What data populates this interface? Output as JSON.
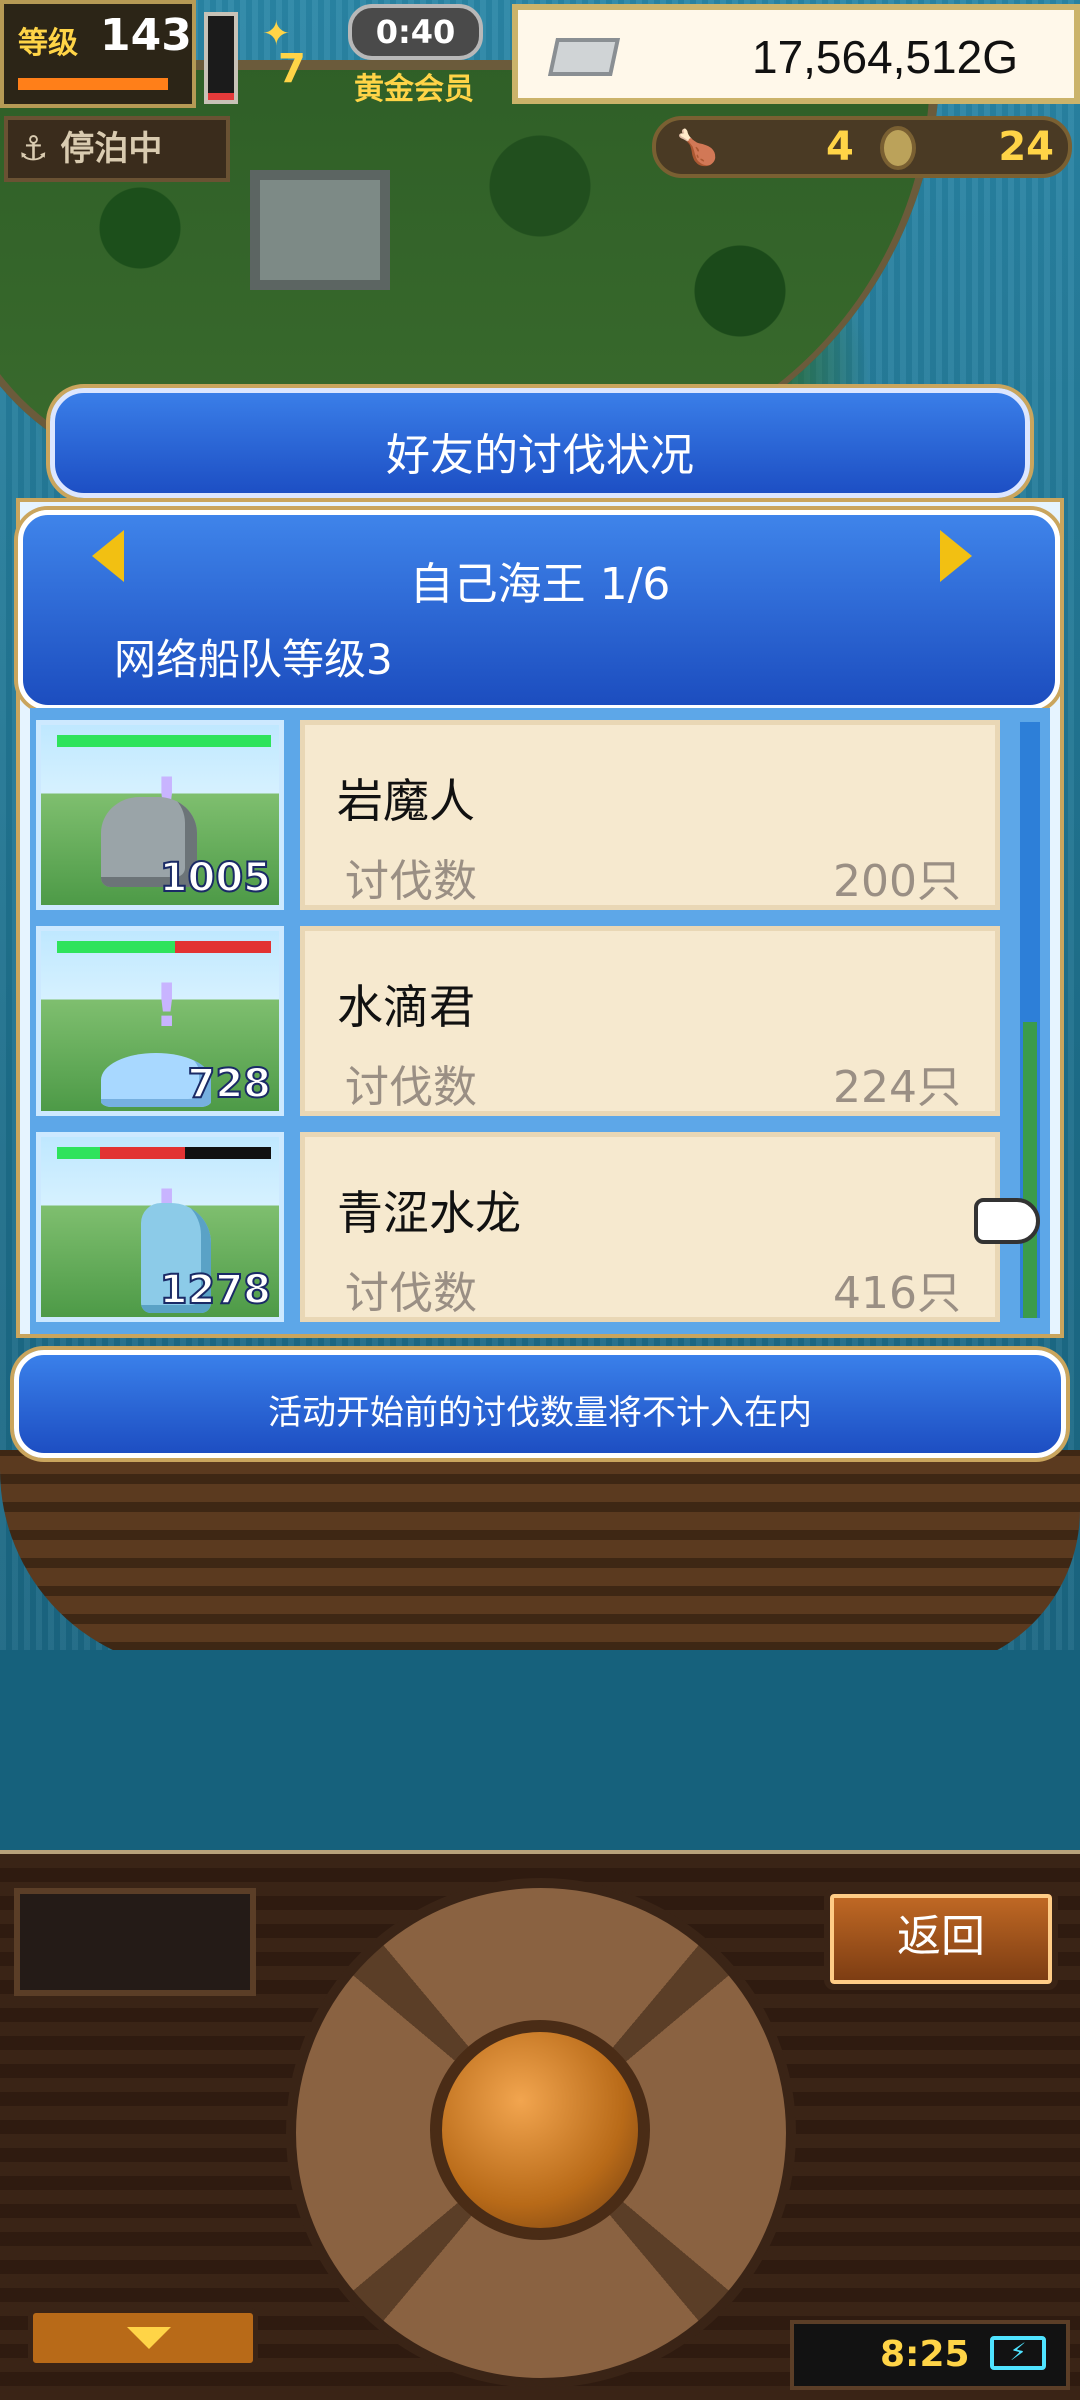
{
  "hud": {
    "level_label": "等级",
    "level_value": "143",
    "stamina_value": "7",
    "timer": "0:40",
    "membership": "黄金会员",
    "money": "17,564,512G",
    "status": "停泊中",
    "resource_a": "4",
    "resource_b": "24",
    "level_progress": 1.0,
    "hp_fraction": 0.08
  },
  "dialog": {
    "title": "好友的讨伐状况",
    "header_title": "自己海王 1/6",
    "header_subtitle": "网络船队等级3",
    "note": "活动开始前的讨伐数量将不计入在内"
  },
  "rows": [
    {
      "name": "岩魔人",
      "label": "讨伐数",
      "count": "200只",
      "level": "1005",
      "hp_green": 1.0,
      "hp_red": 0.0
    },
    {
      "name": "水滴君",
      "label": "讨伐数",
      "count": "224只",
      "level": "728",
      "hp_green": 0.55,
      "hp_red": 0.45
    },
    {
      "name": "青涩水龙",
      "label": "讨伐数",
      "count": "416只",
      "level": "1278",
      "hp_green": 0.2,
      "hp_red": 0.4
    }
  ],
  "bottom": {
    "back_label": "返回",
    "clock": "8:25"
  },
  "icons": {
    "anchor": "anchor-icon",
    "money": "silver-bar-icon",
    "food": "food-icon",
    "coin": "coin-icon",
    "battery": "battery-icon",
    "hand_pointer": "hand-pointer-icon"
  },
  "colors": {
    "panel_blue": "#1d4fc4",
    "card_beige": "#f6e9cf",
    "accent_gold": "#ffd447"
  }
}
